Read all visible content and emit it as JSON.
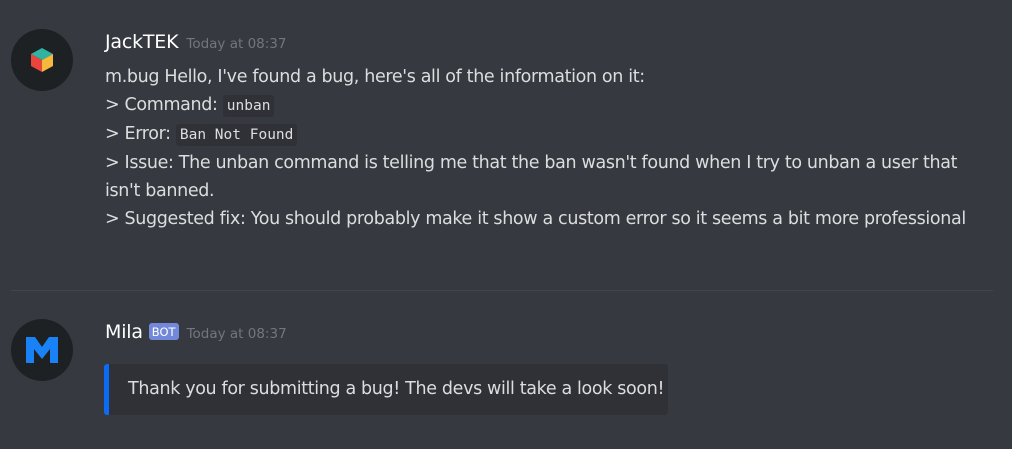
{
  "colors": {
    "background": "#36393f",
    "embed_background": "#2f3136",
    "embed_accent": "#0a6cf5",
    "bot_tag": "#7289da",
    "username": "#ffffff",
    "text": "#dcddde",
    "timestamp": "#72767d"
  },
  "messages": [
    {
      "author": "JackTEK",
      "avatar_icon": "colored-cube-icon",
      "timestamp": "Today at 08:37",
      "lines": [
        {
          "text": "m.bug Hello, I've found a bug, here's all of the information on it:"
        },
        {
          "prefix": "> Command: ",
          "code": "unban"
        },
        {
          "prefix": "> Error: ",
          "code": "Ban Not Found"
        },
        {
          "text": "> Issue: The unban command is telling me that the ban wasn't found when I try to unban a user that isn't banned."
        },
        {
          "text": "> Suggested fix: You should probably make it show a custom error so it seems a bit more professional"
        }
      ]
    },
    {
      "author": "Mila",
      "bot_tag": "BOT",
      "avatar_icon": "mila-m-logo-icon",
      "timestamp": "Today at 08:37",
      "embed": {
        "description": "Thank you for submitting a bug! The devs will take a look soon!"
      }
    }
  ]
}
